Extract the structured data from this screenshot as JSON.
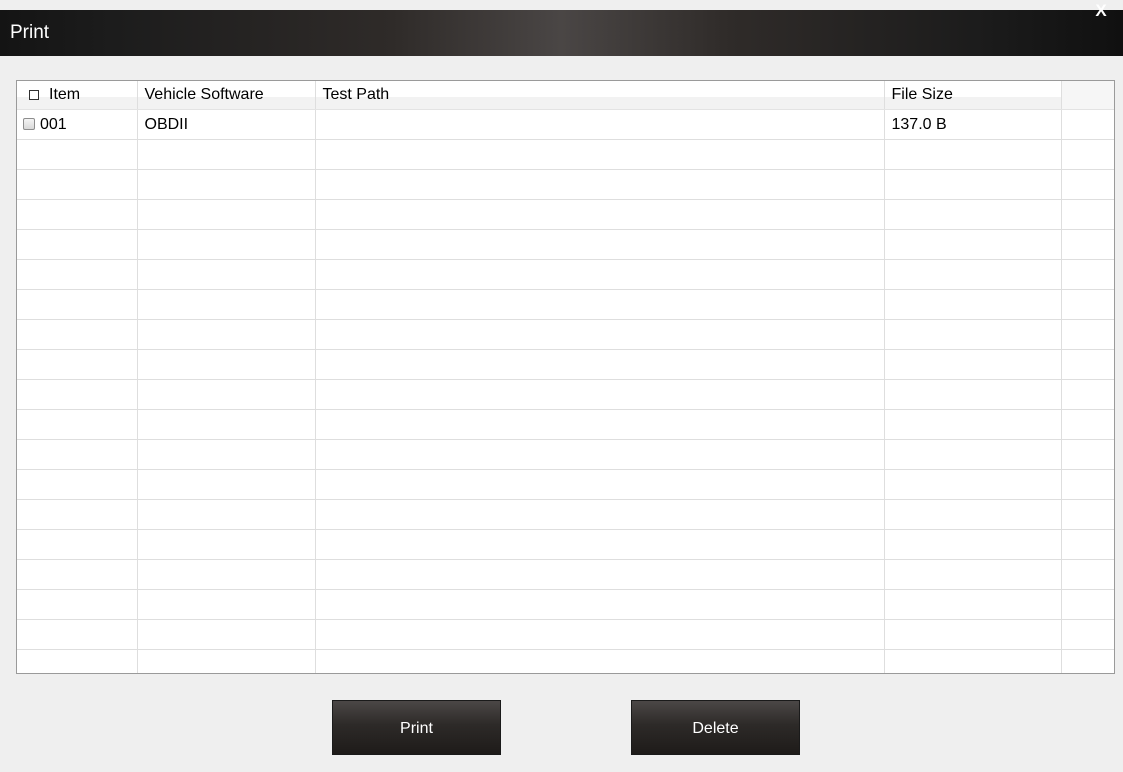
{
  "window": {
    "title": "Print",
    "close_label": "X"
  },
  "table": {
    "columns": {
      "item": "Item",
      "vehicle_software": "Vehicle Software",
      "test_path": "Test Path",
      "file_size": "File Size"
    },
    "rows": [
      {
        "item": "001",
        "vehicle_software": "OBDII",
        "test_path": "",
        "file_size": "137.0 B",
        "checked": false
      }
    ]
  },
  "buttons": {
    "print_label": "Print",
    "delete_label": "Delete"
  }
}
